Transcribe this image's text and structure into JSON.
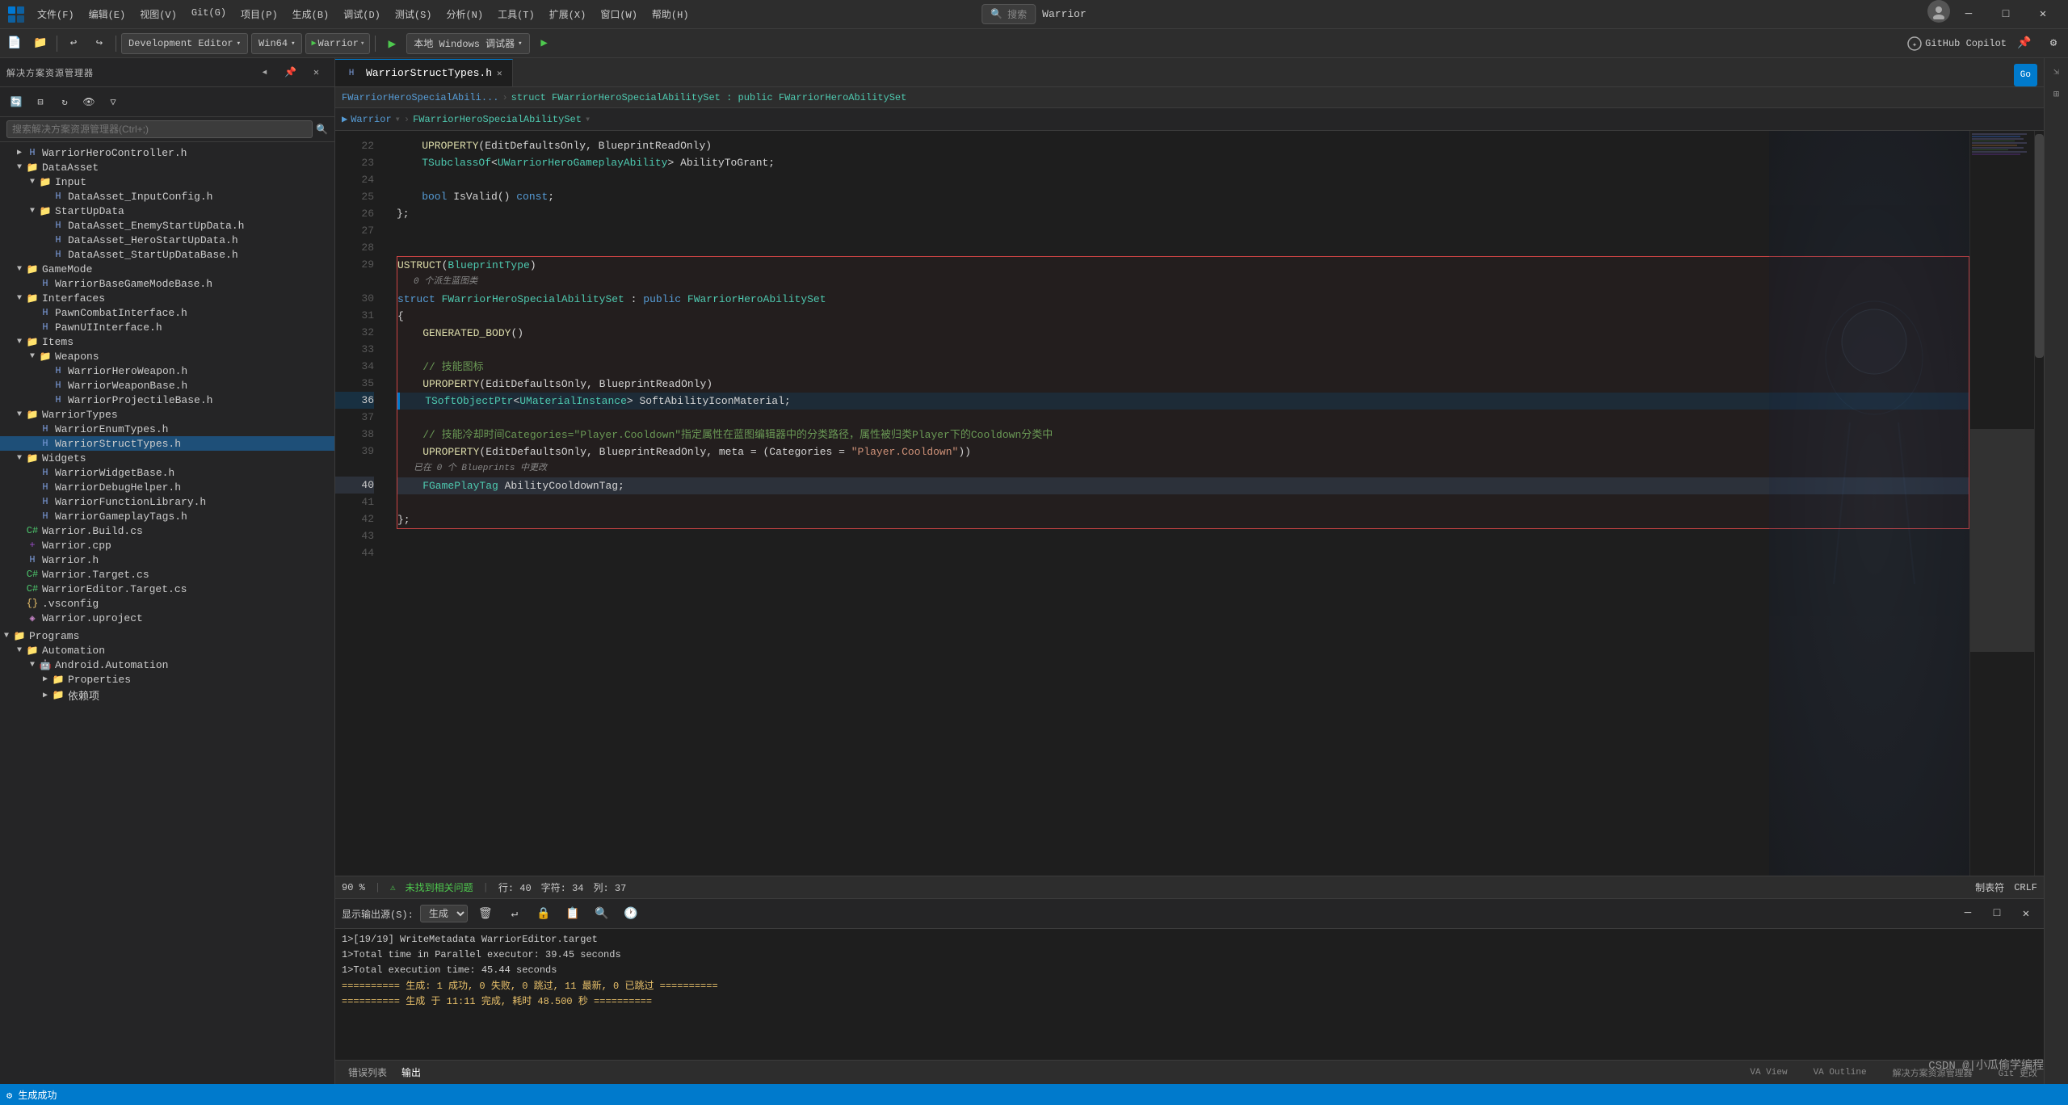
{
  "titlebar": {
    "title": "Warrior",
    "menus": [
      "文件(F)",
      "编辑(E)",
      "视图(V)",
      "Git(G)",
      "项目(P)",
      "生成(B)",
      "调试(D)",
      "测试(S)",
      "分析(N)",
      "工具(T)",
      "扩展(X)",
      "窗口(W)",
      "帮助(H)"
    ],
    "search_placeholder": "搜索",
    "config_dropdown": "Development Editor",
    "platform_dropdown": "Win64",
    "warrior_dropdown": "Warrior",
    "debug_label": "本地 Windows 调试器",
    "copilot_label": "GitHub Copilot"
  },
  "sidebar": {
    "header": "解决方案资源管理器",
    "search_placeholder": "搜索解决方案资源管理器(Ctrl+;)",
    "tree": [
      {
        "level": 1,
        "type": "folder",
        "label": "WarriorHeroController.h",
        "expanded": false
      },
      {
        "level": 1,
        "type": "folder",
        "label": "DataAsset",
        "expanded": true
      },
      {
        "level": 2,
        "type": "folder",
        "label": "Input",
        "expanded": true
      },
      {
        "level": 3,
        "type": "file-h",
        "label": "DataAsset_InputConfig.h"
      },
      {
        "level": 2,
        "type": "folder",
        "label": "StartUpData",
        "expanded": true
      },
      {
        "level": 3,
        "type": "file-h",
        "label": "DataAsset_EnemyStartUpData.h"
      },
      {
        "level": 3,
        "type": "file-h",
        "label": "DataAsset_HeroStartUpData.h"
      },
      {
        "level": 3,
        "type": "file-h",
        "label": "DataAsset_StartUpDataBase.h"
      },
      {
        "level": 1,
        "type": "folder",
        "label": "GameMode",
        "expanded": true
      },
      {
        "level": 2,
        "type": "file-h",
        "label": "WarriorBaseGameModeBase.h"
      },
      {
        "level": 1,
        "type": "folder",
        "label": "Interfaces",
        "expanded": true
      },
      {
        "level": 2,
        "type": "file-h",
        "label": "PawnCombatInterface.h"
      },
      {
        "level": 2,
        "type": "file-h",
        "label": "PawnUIInterface.h"
      },
      {
        "level": 1,
        "type": "folder",
        "label": "Items",
        "expanded": true
      },
      {
        "level": 2,
        "type": "folder",
        "label": "Weapons",
        "expanded": true
      },
      {
        "level": 3,
        "type": "file-h",
        "label": "WarriorHeroWeapon.h"
      },
      {
        "level": 3,
        "type": "file-h",
        "label": "WarriorWeaponBase.h"
      },
      {
        "level": 3,
        "type": "file-h",
        "label": "WarriorProjectileBase.h"
      },
      {
        "level": 1,
        "type": "folder",
        "label": "WarriorTypes",
        "expanded": true
      },
      {
        "level": 2,
        "type": "file-h",
        "label": "WarriorEnumTypes.h"
      },
      {
        "level": 2,
        "type": "file-h",
        "label": "WarriorStructTypes.h",
        "active": true
      },
      {
        "level": 1,
        "type": "folder",
        "label": "Widgets",
        "expanded": true
      },
      {
        "level": 2,
        "type": "file-h",
        "label": "WarriorWidgetBase.h"
      },
      {
        "level": 2,
        "type": "file-h",
        "label": "WarriorDebugHelper.h"
      },
      {
        "level": 2,
        "type": "file-h",
        "label": "WarriorFunctionLibrary.h"
      },
      {
        "level": 2,
        "type": "file-h",
        "label": "WarriorGameplayTags.h"
      },
      {
        "level": 1,
        "type": "file-cs",
        "label": "Warrior.Build.cs"
      },
      {
        "level": 1,
        "type": "file-cpp",
        "label": "Warrior.cpp"
      },
      {
        "level": 1,
        "type": "file-h",
        "label": "Warrior.h"
      },
      {
        "level": 1,
        "type": "file-cs",
        "label": "Warrior.Target.cs"
      },
      {
        "level": 1,
        "type": "file-cs",
        "label": "WarriorEditor.Target.cs"
      },
      {
        "level": 1,
        "type": "file-json",
        "label": ".vsconfig"
      },
      {
        "level": 1,
        "type": "file",
        "label": "Warrior.uproject"
      },
      {
        "level": 0,
        "type": "folder",
        "label": "Programs",
        "expanded": true
      },
      {
        "level": 1,
        "type": "folder",
        "label": "Automation",
        "expanded": true
      },
      {
        "level": 2,
        "type": "folder",
        "label": "Android.Automation",
        "expanded": true
      },
      {
        "level": 3,
        "type": "folder",
        "label": "Properties",
        "expanded": false
      },
      {
        "level": 3,
        "type": "folder",
        "label": "依赖项",
        "expanded": false
      }
    ]
  },
  "tabs": [
    {
      "label": "WarriorStructTypes.h",
      "active": true
    },
    {
      "label": "+",
      "active": false
    }
  ],
  "breadcrumb": {
    "part1": "FWarriorHeroSpecialAbili...",
    "part2": "struct FWarriorHeroSpecialAbilitySet : public FWarriorHeroAbilitySet"
  },
  "breadcrumb2": {
    "part1": "Warrior",
    "part2": "FWarriorHeroSpecialAbilitySet"
  },
  "code": {
    "lines": [
      {
        "num": 22,
        "content": "    UPROPERTY(EditDefaultsOnly, BlueprintReadOnly)",
        "tokens": [
          {
            "t": "macro",
            "v": "    UPROPERTY"
          },
          {
            "t": "plain",
            "v": "(EditDefaultsOnly, BlueprintReadOnly)"
          }
        ]
      },
      {
        "num": 23,
        "content": "    TSubclassOf<UWarriorHeroGameplayAbility> AbilityToGrant;",
        "tokens": [
          {
            "t": "type",
            "v": "    TSubclassOf"
          },
          {
            "t": "plain",
            "v": "<"
          },
          {
            "t": "type",
            "v": "UWarriorHeroGameplayAbility"
          },
          {
            "t": "plain",
            "v": "> AbilityToGrant;"
          }
        ]
      },
      {
        "num": 24,
        "content": ""
      },
      {
        "num": 25,
        "content": "    bool IsValid() const;",
        "tokens": [
          {
            "t": "kw",
            "v": "    bool"
          },
          {
            "t": "plain",
            "v": " IsValid() "
          },
          {
            "t": "kw",
            "v": "const"
          },
          {
            "t": "plain",
            "v": ";"
          }
        ]
      },
      {
        "num": 26,
        "content": "};",
        "tokens": [
          {
            "t": "plain",
            "v": "};"
          }
        ]
      },
      {
        "num": 27,
        "content": ""
      },
      {
        "num": 28,
        "content": ""
      },
      {
        "num": 29,
        "content": "USTRUCT(BlueprintType)",
        "struct_start": true,
        "tokens": [
          {
            "t": "macro",
            "v": "USTRUCT"
          },
          {
            "t": "plain",
            "v": "("
          },
          {
            "t": "type",
            "v": "BlueprintType"
          },
          {
            "t": "plain",
            "v": ")"
          }
        ]
      },
      {
        "num": "29-hint",
        "hint": "0 个派生蓝图类"
      },
      {
        "num": 30,
        "content": "struct FWarriorHeroSpecialAbilitySet : public FWarriorHeroAbilitySet",
        "tokens": [
          {
            "t": "kw",
            "v": "struct"
          },
          {
            "t": "plain",
            "v": " "
          },
          {
            "t": "type",
            "v": "FWarriorHeroSpecialAbilitySet"
          },
          {
            "t": "plain",
            "v": " : "
          },
          {
            "t": "kw",
            "v": "public"
          },
          {
            "t": "plain",
            "v": " "
          },
          {
            "t": "type",
            "v": "FWarriorHeroAbilitySet"
          }
        ]
      },
      {
        "num": 31,
        "content": "{",
        "tokens": [
          {
            "t": "plain",
            "v": "{"
          }
        ]
      },
      {
        "num": 32,
        "content": "    GENERATED_BODY()",
        "tokens": [
          {
            "t": "macro",
            "v": "    GENERATED_BODY"
          },
          {
            "t": "plain",
            "v": "()"
          }
        ]
      },
      {
        "num": 33,
        "content": ""
      },
      {
        "num": 34,
        "content": "    // 技能图标",
        "tokens": [
          {
            "t": "comment",
            "v": "    // 技能图标"
          }
        ]
      },
      {
        "num": 35,
        "content": "    UPROPERTY(EditDefaultsOnly, BlueprintReadOnly)",
        "tokens": [
          {
            "t": "macro",
            "v": "    UPROPERTY"
          },
          {
            "t": "plain",
            "v": "(EditDefaultsOnly, BlueprintReadOnly)"
          }
        ]
      },
      {
        "num": 36,
        "content": "    TSoftObjectPtr<UMaterialInstance> SoftAbilityIconMaterial;",
        "active": true,
        "tokens": [
          {
            "t": "type",
            "v": "    TSoftObjectPtr"
          },
          {
            "t": "plain",
            "v": "<"
          },
          {
            "t": "type",
            "v": "UMaterialInstance"
          },
          {
            "t": "plain",
            "v": "> SoftAbilityIconMaterial;"
          }
        ]
      },
      {
        "num": 37,
        "content": ""
      },
      {
        "num": 38,
        "content": "    // 技能冷却时间Categories=\"Player.Cooldown\"指定属性在蓝图编辑器中的分类路径，属性被归类Player下的Cooldown分类中",
        "tokens": [
          {
            "t": "comment",
            "v": "    // 技能冷却时间Categories=\"Player.Cooldown\"指定属性在蓝图编辑器中的分类路径，属性被归类Player下的Cooldown分类中"
          }
        ]
      },
      {
        "num": 39,
        "content": "    UPROPERTY(EditDefaultsOnly, BlueprintReadOnly, meta = (Categories = \"Player.Cooldown\"))",
        "tokens": [
          {
            "t": "macro",
            "v": "    UPROPERTY"
          },
          {
            "t": "plain",
            "v": "(EditDefaultsOnly, BlueprintReadOnly, meta = (Categories = "
          },
          {
            "t": "string",
            "v": "\"Player.Cooldown\""
          },
          {
            "t": "plain",
            "v": "))"
          }
        ]
      },
      {
        "num": "39-hint",
        "hint": "已在 0 个 Blueprints 中更改"
      },
      {
        "num": 40,
        "content": "    FGamePlayTag AbilityCooldownTag;",
        "active_line": true,
        "tokens": [
          {
            "t": "type",
            "v": "    FGamePlayTag"
          },
          {
            "t": "plain",
            "v": " AbilityCooldownTag;"
          }
        ]
      },
      {
        "num": 41,
        "content": ""
      },
      {
        "num": 42,
        "content": "};",
        "struct_end": true,
        "tokens": [
          {
            "t": "plain",
            "v": "};"
          }
        ]
      },
      {
        "num": 43,
        "content": ""
      },
      {
        "num": 44,
        "content": ""
      }
    ]
  },
  "statusbar": {
    "zoom": "90 %",
    "errors": "未找到相关问题",
    "line": "行: 40",
    "col": "字符: 34",
    "column2": "列: 37",
    "encoding": "制表符",
    "lineending": "CRLF"
  },
  "panel": {
    "tabs": [
      "错误列表",
      "输出"
    ],
    "active_tab": "输出",
    "output_source_label": "显示输出源(S):",
    "output_source_value": "生成",
    "output_lines": [
      "1>[19/19] WriteMetadata WarriorEditor.target",
      "1>Total time in Parallel executor: 39.45 seconds",
      "1>Total execution time: 45.44 seconds",
      "========== 生成: 1 成功, 0 失败, 0 跳过, 11 最新, 0 已跳过 ==========",
      "========== 生成 于 11:11 完成, 耗时 48.500 秒 =========="
    ]
  },
  "bottom_tabs": [
    "VA View",
    "VA Outline",
    "解决方案资源管理器",
    "Git 更改"
  ],
  "bottom_status": "⚙ 生成成功",
  "watermark": "CSDN @|小瓜偷学编程"
}
